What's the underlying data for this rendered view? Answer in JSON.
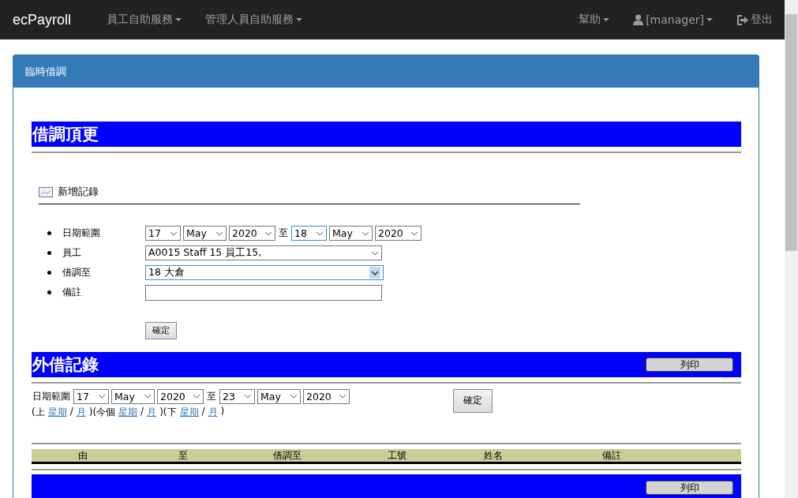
{
  "navbar": {
    "brand": "ecPayroll",
    "left_menus": [
      {
        "label": "員工自助服務"
      },
      {
        "label": "管理人員自助服務"
      }
    ],
    "right_menus": [
      {
        "label": "幫助",
        "kind": "plain"
      },
      {
        "label": "[manager]",
        "kind": "user"
      },
      {
        "label": "登出",
        "kind": "logout"
      }
    ]
  },
  "panel": {
    "title": "臨時借調"
  },
  "assign_section": {
    "heading": "借調頂更",
    "add_link": "新增記錄",
    "date_range": {
      "label": "日期範圍",
      "from": {
        "day": "17",
        "month": "May",
        "year": "2020"
      },
      "separator": "至",
      "to": {
        "day": "18",
        "month": "May",
        "year": "2020",
        "day_focused": true
      }
    },
    "fields": [
      {
        "label": "員工",
        "kind": "select",
        "value": "A0015 Staff 15 員工15,",
        "hovered": false
      },
      {
        "label": "借調至",
        "kind": "select",
        "value": "18 大倉",
        "hovered": true
      },
      {
        "label": "備註",
        "kind": "text"
      }
    ],
    "submit": "確定"
  },
  "records_section": {
    "heading": "外借記錄",
    "print_button": "列印",
    "filter": {
      "label": "日期範圍",
      "from": {
        "day": "17",
        "month": "May",
        "year": "2020"
      },
      "separator": "至",
      "to": {
        "day": "23",
        "month": "May",
        "year": "2020"
      },
      "submit": "確定"
    },
    "period_links": [
      {
        "kind": "text",
        "text": "(上"
      },
      {
        "kind": "link",
        "text": "星期"
      },
      {
        "kind": "text",
        "text": "/"
      },
      {
        "kind": "link",
        "text": "月"
      },
      {
        "kind": "text",
        "text": ")(今個"
      },
      {
        "kind": "link",
        "text": "星期"
      },
      {
        "kind": "text",
        "text": "/"
      },
      {
        "kind": "link",
        "text": "月"
      },
      {
        "kind": "text",
        "text": ")(下"
      },
      {
        "kind": "link",
        "text": "星期"
      },
      {
        "kind": "text",
        "text": "/"
      },
      {
        "kind": "link",
        "text": "月"
      },
      {
        "kind": "text",
        "text": ")"
      }
    ],
    "table": {
      "columns": [
        "由",
        "至",
        "借調至",
        "工號",
        "姓名",
        "備註"
      ]
    },
    "footer_print_button": "列印"
  }
}
